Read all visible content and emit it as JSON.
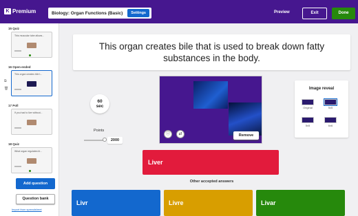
{
  "header": {
    "brand": "Premium",
    "quiz_title": "Biology: Organ Functions (Basic)",
    "settings_label": "Settings",
    "preview_label": "Preview",
    "exit_label": "Exit",
    "done_label": "Done"
  },
  "sidebar": {
    "items": [
      {
        "header": "15  Quiz",
        "text": "This muscular tube allows..."
      },
      {
        "header": "16  Open-ended",
        "text": "This organ creates bile t..."
      },
      {
        "header": "17  Poll",
        "text": "If you had to live without..."
      },
      {
        "header": "18  Quiz",
        "text": "What organ regulates bl..."
      }
    ],
    "add_question_label": "Add question",
    "question_bank_label": "Question bank",
    "import_label": "Import from spreadsheet"
  },
  "question": {
    "text": "This organ creates bile that is used to break down fatty substances in the body.",
    "timer_value": "60",
    "timer_unit": "sec",
    "points_label": "Points",
    "points_value": "2000",
    "remove_label": "Remove"
  },
  "image_reveal": {
    "title": "Image reveal",
    "options": [
      {
        "label": "Original",
        "selected": false
      },
      {
        "label": "5x5",
        "selected": true
      },
      {
        "label": "5x5",
        "selected": false
      },
      {
        "label": "6x6",
        "selected": false
      }
    ]
  },
  "answers": {
    "primary": "Liver",
    "other_label": "Other accepted answers",
    "alternates": [
      "Livr",
      "Livre",
      "Livar"
    ]
  },
  "colors": {
    "brand_purple": "#46178f",
    "accent_blue": "#1368ce",
    "red": "#e21b3c",
    "blue": "#1368ce",
    "yellow": "#d89e00",
    "green": "#26890c"
  }
}
